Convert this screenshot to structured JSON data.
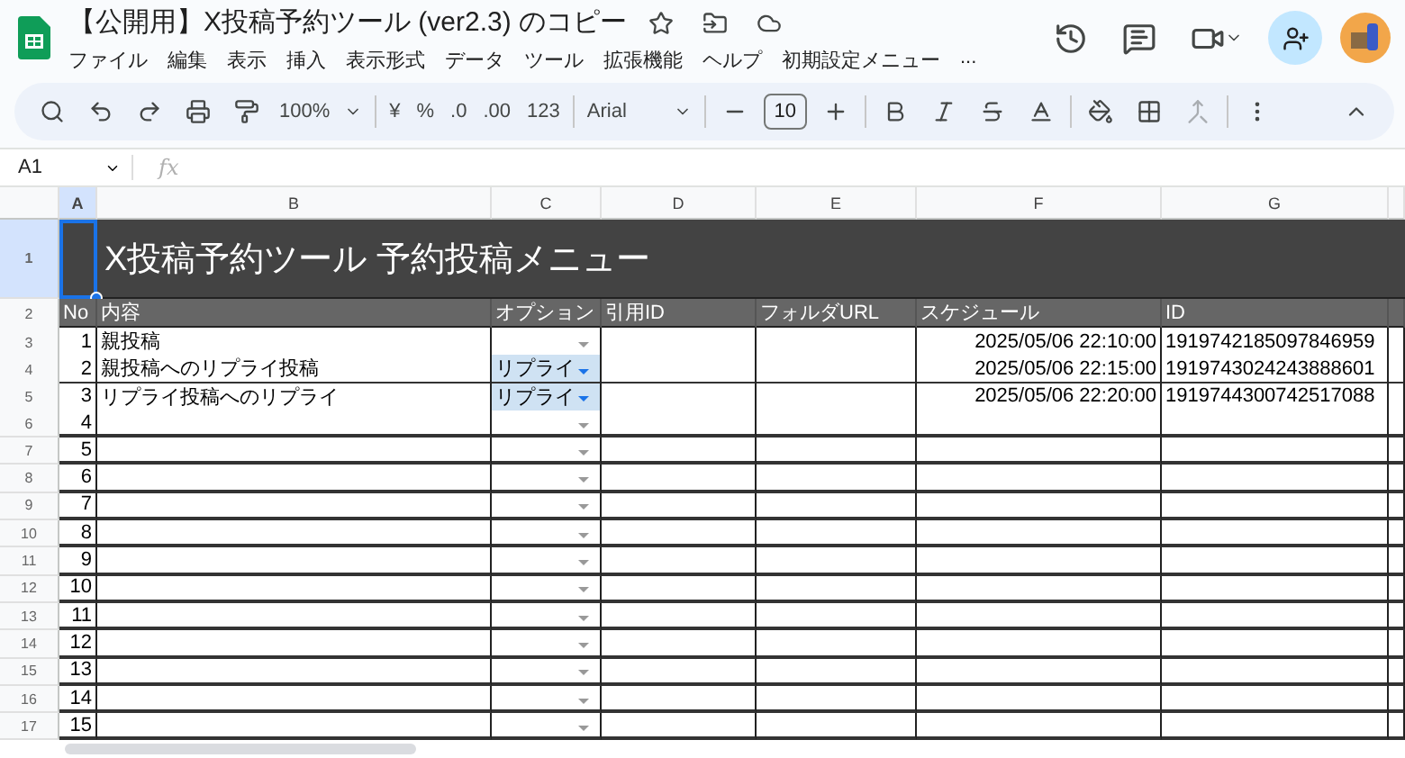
{
  "doc": {
    "title": "【公開用】X投稿予約ツール (ver2.3) のコピー",
    "menus": [
      "ファイル",
      "編集",
      "表示",
      "挿入",
      "表示形式",
      "データ",
      "ツール",
      "拡張機能",
      "ヘルプ",
      "初期設定メニュー",
      "..."
    ]
  },
  "toolbar": {
    "zoom": "100%",
    "currency": "¥",
    "percent": "%",
    "decrease_decimal": ".0",
    "increase_decimal": ".00",
    "number_format": "123",
    "font": "Arial",
    "font_size": "10"
  },
  "formula_bar": {
    "cell_ref": "A1",
    "fx": "fx"
  },
  "columns": [
    {
      "letter": "A",
      "selected": true
    },
    {
      "letter": "B",
      "selected": false
    },
    {
      "letter": "C",
      "selected": false
    },
    {
      "letter": "D",
      "selected": false
    },
    {
      "letter": "E",
      "selected": false
    },
    {
      "letter": "F",
      "selected": false
    },
    {
      "letter": "G",
      "selected": false
    }
  ],
  "row_labels": [
    {
      "label": "1",
      "selected": true
    },
    {
      "label": "2",
      "selected": false
    },
    {
      "label": "3",
      "selected": false
    },
    {
      "label": "4",
      "selected": false
    },
    {
      "label": "5",
      "selected": false
    },
    {
      "label": "6",
      "selected": false
    },
    {
      "label": "7",
      "selected": false
    },
    {
      "label": "8",
      "selected": false
    },
    {
      "label": "9",
      "selected": false
    },
    {
      "label": "10",
      "selected": false
    },
    {
      "label": "11",
      "selected": false
    },
    {
      "label": "12",
      "selected": false
    },
    {
      "label": "13",
      "selected": false
    },
    {
      "label": "14",
      "selected": false
    },
    {
      "label": "15",
      "selected": false
    },
    {
      "label": "16",
      "selected": false
    },
    {
      "label": "17",
      "selected": false
    }
  ],
  "sheet_title": "X投稿予約ツール 予約投稿メニュー",
  "headers": [
    "No",
    "内容",
    "オプション",
    "引用ID",
    "フォルダURL",
    "スケジュール",
    "ID"
  ],
  "rows": [
    {
      "no": "1",
      "content": "親投稿",
      "schedule": "2025/05/06 22:10:00",
      "id": "1919742185097846959"
    },
    {
      "no": "2",
      "content": "親投稿へのリプライ投稿",
      "option": "リプライ",
      "schedule": "2025/05/06 22:15:00",
      "id": "1919743024243888601"
    },
    {
      "no": "3",
      "content": "リプライ投稿へのリプライ",
      "option": "リプライ",
      "schedule": "2025/05/06 22:20:00",
      "id": "1919744300742517088"
    },
    {
      "no": "4"
    },
    {
      "no": "5"
    },
    {
      "no": "6"
    },
    {
      "no": "7"
    },
    {
      "no": "8"
    },
    {
      "no": "9"
    },
    {
      "no": "10"
    },
    {
      "no": "11"
    },
    {
      "no": "12"
    },
    {
      "no": "13"
    },
    {
      "no": "14"
    },
    {
      "no": "15"
    }
  ]
}
